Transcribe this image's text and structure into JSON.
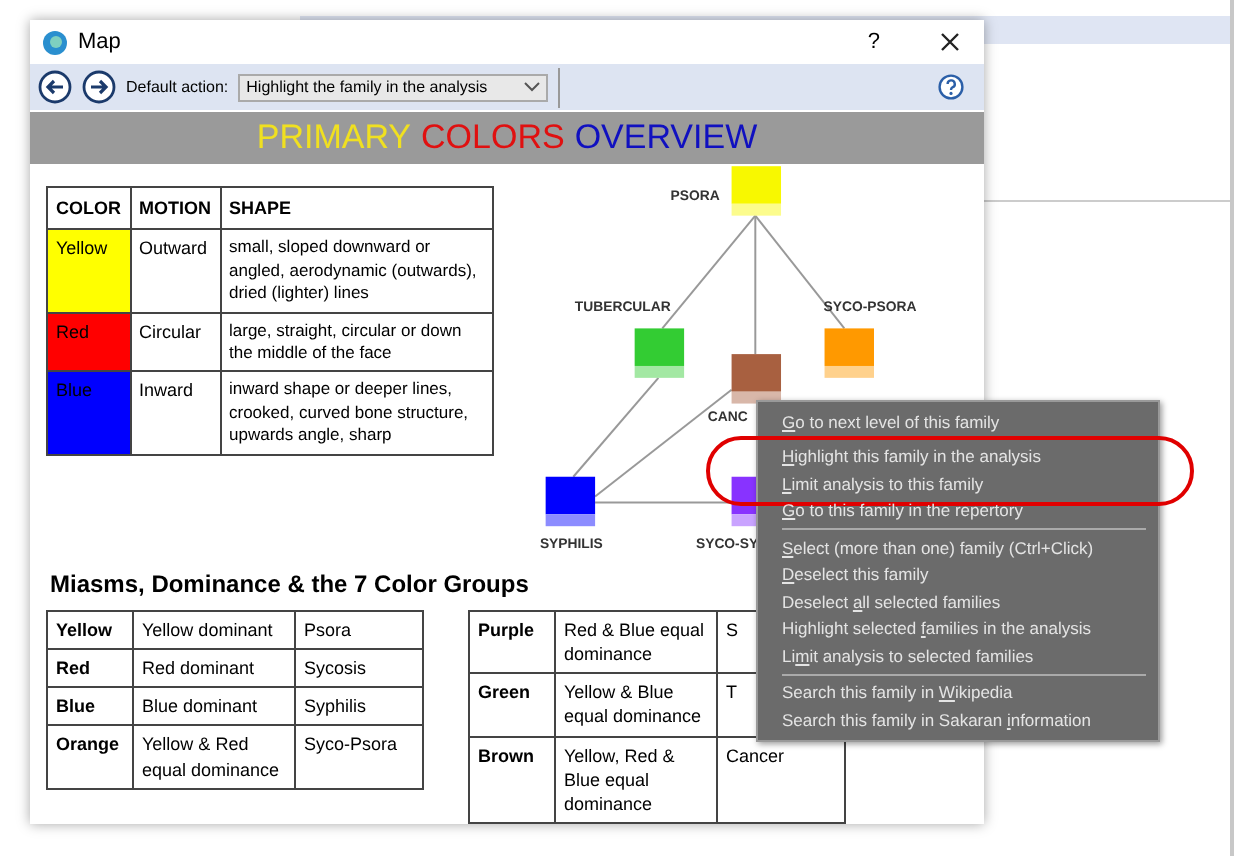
{
  "window": {
    "title": "Map",
    "help": "?"
  },
  "toolbar": {
    "label": "Default action:",
    "value": "Highlight the family in the analysis"
  },
  "banner": [
    {
      "text": "PRIMARY",
      "color": "#f0e020"
    },
    {
      "text": "COLORS",
      "color": "#e01010"
    },
    {
      "text": "OVERVIEW",
      "color": "#1010c0"
    }
  ],
  "overview_table": {
    "columns": [
      "COLOR",
      "MOTION",
      "SHAPE"
    ],
    "rows": [
      {
        "color_name": "Yellow",
        "color": "#ffff00",
        "motion": "Outward",
        "shape": "small, sloped downward or angled, aerodynamic (outwards), dried (lighter) lines"
      },
      {
        "color_name": "Red",
        "color": "#ff0000",
        "motion": "Circular",
        "shape": "large, straight, circular or down the middle of the face"
      },
      {
        "color_name": "Blue",
        "color": "#0000ff",
        "motion": "Inward",
        "shape": "inward shape or deeper lines, crooked, curved bone structure, upwards angle, sharp"
      }
    ]
  },
  "diagram": {
    "nodes": [
      {
        "label": "PSORA",
        "color": "#f8f800"
      },
      {
        "label": "TUBERCULAR",
        "color": "#33cc33"
      },
      {
        "label": "CANC",
        "color": "#a86040"
      },
      {
        "label": "SYCO-PSORA",
        "color": "#ff9900"
      },
      {
        "label": "SYPHILIS",
        "color": "#0000ff"
      },
      {
        "label": "SYCO-SY",
        "color": "#8833ff"
      }
    ]
  },
  "groups_heading": "Miasms, Dominance & the 7 Color Groups",
  "groups_tables": [
    {
      "rows": [
        [
          "Yellow",
          "Yellow dominant",
          "Psora"
        ],
        [
          "Red",
          "Red dominant",
          "Sycosis"
        ],
        [
          "Blue",
          "Blue dominant",
          "Syphilis"
        ],
        [
          "Orange",
          "Yellow & Red equal dominance",
          "Syco-Psora"
        ]
      ]
    },
    {
      "rows": [
        [
          "Purple",
          "Red & Blue equal dominance",
          "S"
        ],
        [
          "Green",
          "Yellow & Blue equal dominance",
          "T"
        ],
        [
          "Brown",
          "Yellow, Red & Blue equal dominance",
          "Cancer"
        ]
      ]
    }
  ],
  "context_menu": [
    {
      "kind": "group",
      "circled": false,
      "items": [
        {
          "key": "G",
          "post": "o to next level of this family"
        }
      ]
    },
    {
      "kind": "group",
      "circled": true,
      "items": [
        {
          "key": "H",
          "post": "ighlight this family in the analysis"
        },
        {
          "key": "L",
          "post": "imit analysis to this family"
        }
      ]
    },
    {
      "kind": "group",
      "circled": false,
      "items": [
        {
          "key": "G",
          "post": "o to this family in the repertory"
        }
      ]
    },
    {
      "kind": "separator"
    },
    {
      "kind": "group",
      "circled": false,
      "items": [
        {
          "key": "S",
          "post": "elect (more than one) family (Ctrl+Click)"
        },
        {
          "key": "D",
          "post": "eselect this family"
        },
        {
          "pre": "Deselect ",
          "key": "a",
          "post": "ll selected families"
        },
        {
          "pre": "Highlight selected ",
          "key": "f",
          "post": "amilies in the analysis"
        },
        {
          "pre": "Li",
          "key": "m",
          "post": "it analysis to selected families"
        }
      ]
    },
    {
      "kind": "separator"
    },
    {
      "kind": "group",
      "circled": false,
      "items": [
        {
          "pre": "Search this family in ",
          "key": "W",
          "post": "ikipedia"
        },
        {
          "pre": "Search this family in Sakaran ",
          "key": "i",
          "post": "nformation"
        }
      ]
    }
  ]
}
